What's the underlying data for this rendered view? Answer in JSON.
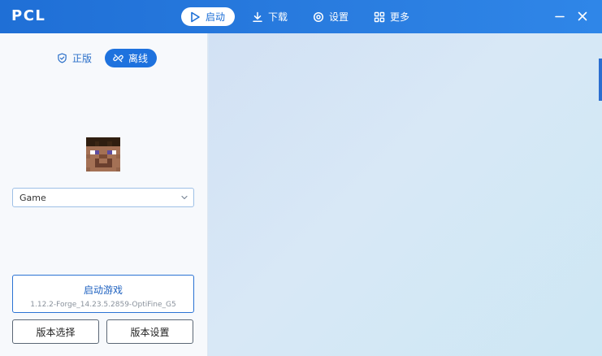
{
  "app": {
    "logo": "PCL"
  },
  "nav": {
    "launch": "启动",
    "download": "下载",
    "settings": "设置",
    "more": "更多"
  },
  "mode": {
    "official": "正版",
    "offline": "离线"
  },
  "profile": {
    "selected": "Game"
  },
  "launch": {
    "title": "启动游戏",
    "version": "1.12.2-Forge_14.23.5.2859-OptiFine_G5"
  },
  "buttons": {
    "version_select": "版本选择",
    "version_settings": "版本设置"
  },
  "colors": {
    "titlebar": "#1f6fd6",
    "accent": "#1e72de",
    "sidebar_bg": "#f7f9fc",
    "main_bg": "#d6e6f6"
  },
  "icons": {
    "launch": "play-icon",
    "download": "download-icon",
    "settings": "gear-icon",
    "more": "grid-icon",
    "official": "shield-check-icon",
    "offline": "link-off-icon",
    "minimize": "minimize-icon",
    "close": "close-icon"
  }
}
